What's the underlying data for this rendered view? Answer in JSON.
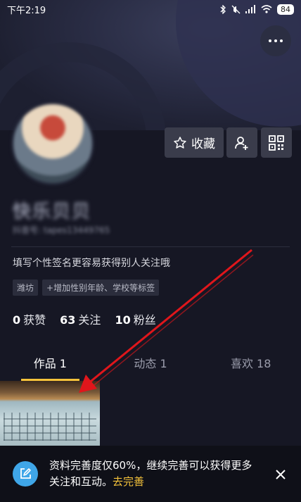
{
  "status": {
    "time": "下午2:19",
    "battery": "84"
  },
  "profile": {
    "name": "快乐贝贝",
    "uid": "抖音号: tapes13449765",
    "bio_placeholder": "填写个性签名更容易获得别人关注哦",
    "tags": [
      "潍坊",
      "+增加性别年龄、学校等标签"
    ]
  },
  "actions": {
    "favorite_label": "收藏"
  },
  "stats": [
    {
      "num": "0",
      "label": "获赞"
    },
    {
      "num": "63",
      "label": "关注"
    },
    {
      "num": "10",
      "label": "粉丝"
    }
  ],
  "tabs": [
    {
      "label": "作品 1",
      "active": true
    },
    {
      "label": "动态 1",
      "active": false
    },
    {
      "label": "喜欢 18",
      "active": false
    }
  ],
  "prompt": {
    "text": "资料完善度仅60%，继续完善可以获得更多关注和互动。",
    "link": "去完善"
  },
  "colors": {
    "accent": "#f5c33b",
    "background": "#161724",
    "annotation": "#e0161b"
  },
  "icons": [
    "star-icon",
    "add-friend-icon",
    "qr-code-icon",
    "more-icon",
    "edit-icon",
    "close-icon"
  ]
}
